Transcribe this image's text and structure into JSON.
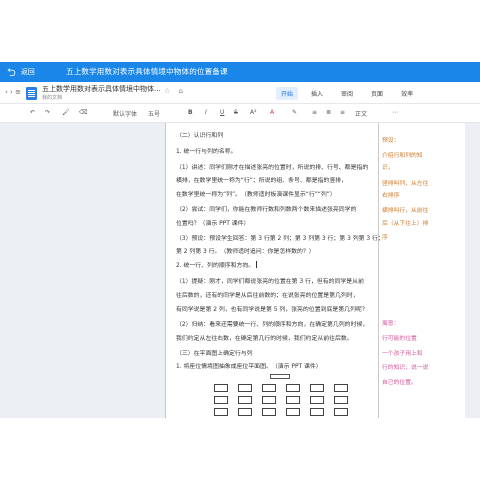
{
  "header": {
    "back_icon": "back-arrow-icon",
    "back_label": "返回",
    "title": "五上数学用数对表示具体情境中物体的位置备课",
    "colors": {
      "bar": "#1a86e8",
      "text": "#ffffff"
    }
  },
  "doc": {
    "name": "五上数学用数对表示具体情境中物体...",
    "location": "我的文档",
    "nav_icons": [
      "back-icon",
      "forward-icon"
    ],
    "action_icons": [
      "star-icon",
      "share-icon"
    ]
  },
  "tabs": [
    {
      "label": "开始",
      "active": true
    },
    {
      "label": "插入",
      "active": false
    },
    {
      "label": "审阅",
      "active": false
    },
    {
      "label": "页面",
      "active": false
    },
    {
      "label": "效率",
      "active": false
    }
  ],
  "format_toolbar": {
    "undo": "↶",
    "redo": "↷",
    "format_painter": "🖌",
    "clear_format": "⌫",
    "font": "默认字体",
    "font_size": "五号",
    "bold": "B",
    "italic": "I",
    "underline": "U",
    "strikethrough": "S",
    "superscript": "A²",
    "font_color": "A",
    "highlight": "✎",
    "list": "≡",
    "line_spacing": "≣",
    "align": "≡",
    "text_style": "正文",
    "more": "⋯"
  },
  "body_lines": [
    "（二）认识行和列",
    "1. 统一行与列的名称。",
    "（1）讲述：同学们刚才在描述张亮的位置时，所说的排、行号、都是指的",
    "横排，在数学里统一称为“行”；所说的组、条号、都是指的竖排，",
    "在数学里统一称为“列”。（教师适时板演课件显示“行”“列”）",
    "（2）尝试：同学们，你能在教师行数和列数两个数来描述张亮同学的",
    "位置吗？（演示 PPT 课件）",
    "（3）预设：预设学生回答：第 3 行第 2 列；第 3 列第 3 行；第 3 列第 3 行；",
    "第 2 列第 3 行。（教师适时追问：你是怎样数的？）",
    "2. 统一行、列的顺序和方向。",
    "（1）提疑：刚才，同学们都说张亮的位置在第 3 行，但有的同学是从前",
    "往后数的，还有的同学是从后往前数的；在说张亮的位置是第几列时，",
    "有同学说是第 2 列，也有同学说是第 5 列，张亮的位置到底是第几列呢？",
    "（2）归纳：看来还需要统一行、列的顺序和方向，在确定第几列的时候，",
    "我们约定从左往右数，在确定第几行的时候，我们约定从前往后数。",
    "（三）在平面图上确定行与列",
    "1. 将座位情境图抽象成座位平面图。（演示 PPT 课件）"
  ],
  "side_notes": [
    {
      "text": "预设：",
      "color": "orange"
    },
    {
      "text": "介绍行和列的知",
      "color": "orange"
    },
    {
      "text": "识，",
      "color": "orange"
    },
    {
      "text": "竖排叫列，从左往",
      "color": "orange"
    },
    {
      "text": "右排序",
      "color": "orange"
    },
    {
      "text": "横排叫行，从前往",
      "color": "orange"
    },
    {
      "text": "后（从下往上）排",
      "color": "orange"
    },
    {
      "text": "序",
      "color": "orange"
    },
    {
      "text": "寓意：",
      "color": "pink"
    },
    {
      "text": "行可能的位置",
      "color": "pink"
    },
    {
      "text": "一个孩子用上和",
      "color": "pink"
    },
    {
      "text": "行的知识，说一说",
      "color": "pink"
    },
    {
      "text": "自己的位置。",
      "color": "pink"
    }
  ]
}
